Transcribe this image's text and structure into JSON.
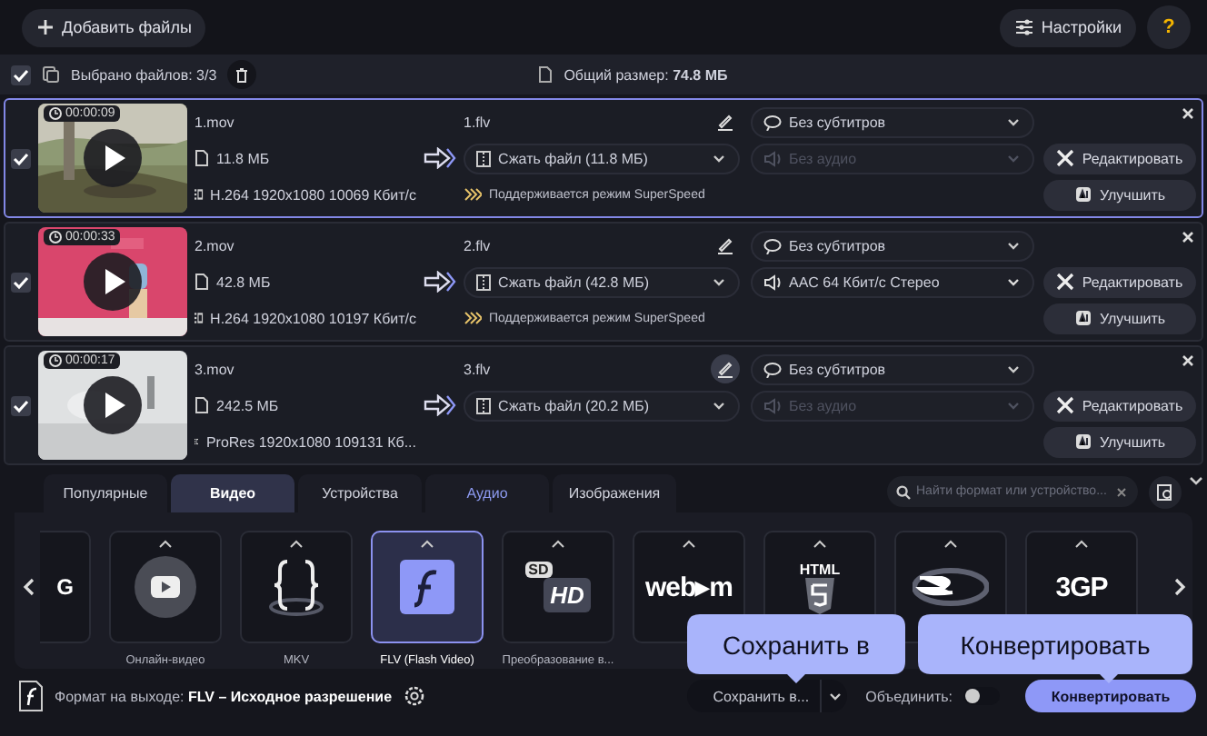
{
  "toolbar": {
    "add_button": "Добавить файлы",
    "settings_button": "Настройки",
    "help_button": "?"
  },
  "selection_bar": {
    "checked": true,
    "selected_label": "Выбрано файлов: 3/3",
    "total_label": "Общий размер: **74.8 МБ**"
  },
  "files": [
    {
      "selected": true,
      "checked": true,
      "duration": "00:00:09",
      "name": "1.mov",
      "size": "11.8 МБ",
      "codec": "H.264 1920x1080 10069 Кбит/с",
      "output_name": "1.flv",
      "rename_active": false,
      "compress": "Сжать файл (11.8 МБ)",
      "superspeed": "Поддерживается режим SuperSpeed",
      "subtitles": "Без субтитров",
      "audio": "Без аудио",
      "audio_disabled": true,
      "edit_button": "Редактировать",
      "enhance_button": "Улучшить"
    },
    {
      "selected": false,
      "checked": true,
      "duration": "00:00:33",
      "name": "2.mov",
      "size": "42.8 МБ",
      "codec": "H.264 1920x1080 10197 Кбит/с",
      "output_name": "2.flv",
      "rename_active": false,
      "compress": "Сжать файл (42.8 МБ)",
      "superspeed": "Поддерживается режим SuperSpeed",
      "subtitles": "Без субтитров",
      "audio": "AAC 64 Кбит/с Стерео",
      "audio_disabled": false,
      "edit_button": "Редактировать",
      "enhance_button": "Улучшить"
    },
    {
      "selected": false,
      "checked": true,
      "duration": "00:00:17",
      "name": "3.mov",
      "size": "242.5 МБ",
      "codec": "ProRes 1920x1080 109131 Кб...",
      "output_name": "3.flv",
      "rename_active": true,
      "compress": "Сжать файл (20.2 МБ)",
      "subtitles": "Без субтитров",
      "audio": "Без аудио",
      "audio_disabled": true,
      "edit_button": "Редактировать",
      "enhance_button": "Улучшить"
    }
  ],
  "format_tabs": [
    {
      "label": "Популярные",
      "selected": false,
      "accent": false
    },
    {
      "label": "Видео",
      "selected": true,
      "accent": false
    },
    {
      "label": "Устройства",
      "selected": false,
      "accent": false
    },
    {
      "label": "Аудио",
      "selected": false,
      "accent": true
    },
    {
      "label": "Изображения",
      "selected": false,
      "accent": false
    }
  ],
  "search": {
    "placeholder": "Найти формат или устройство..."
  },
  "formats": [
    {
      "kind": "text-logo",
      "logo_text": "G",
      "selected": false
    },
    {
      "kind": "play",
      "label": "Онлайн-видео",
      "selected": false
    },
    {
      "kind": "braces",
      "label": "MKV",
      "selected": false
    },
    {
      "kind": "flash",
      "label": "FLV (Flash Video)",
      "selected": true
    },
    {
      "kind": "sdhd",
      "logo_text": "SD",
      "logo_text_2": "HD",
      "label": "Преобразование в...",
      "selected": false
    },
    {
      "kind": "text-logo",
      "logo_text": "web▸m",
      "selected": false
    },
    {
      "kind": "html",
      "logo_text": "HTML",
      "selected": false
    },
    {
      "kind": "disc",
      "selected": false
    },
    {
      "kind": "text-logo",
      "logo_text": "3GP",
      "selected": false
    }
  ],
  "output_bar": {
    "format_label": "Формат на выходе: **FLV – Исходное разрешение**",
    "save_button": "Сохранить в...",
    "merge_label": "Объединить:",
    "merge_on": false,
    "convert_button": "Конвертировать"
  },
  "tooltips": [
    {
      "text": "Сохранить в"
    },
    {
      "text": "Конвертировать"
    }
  ]
}
